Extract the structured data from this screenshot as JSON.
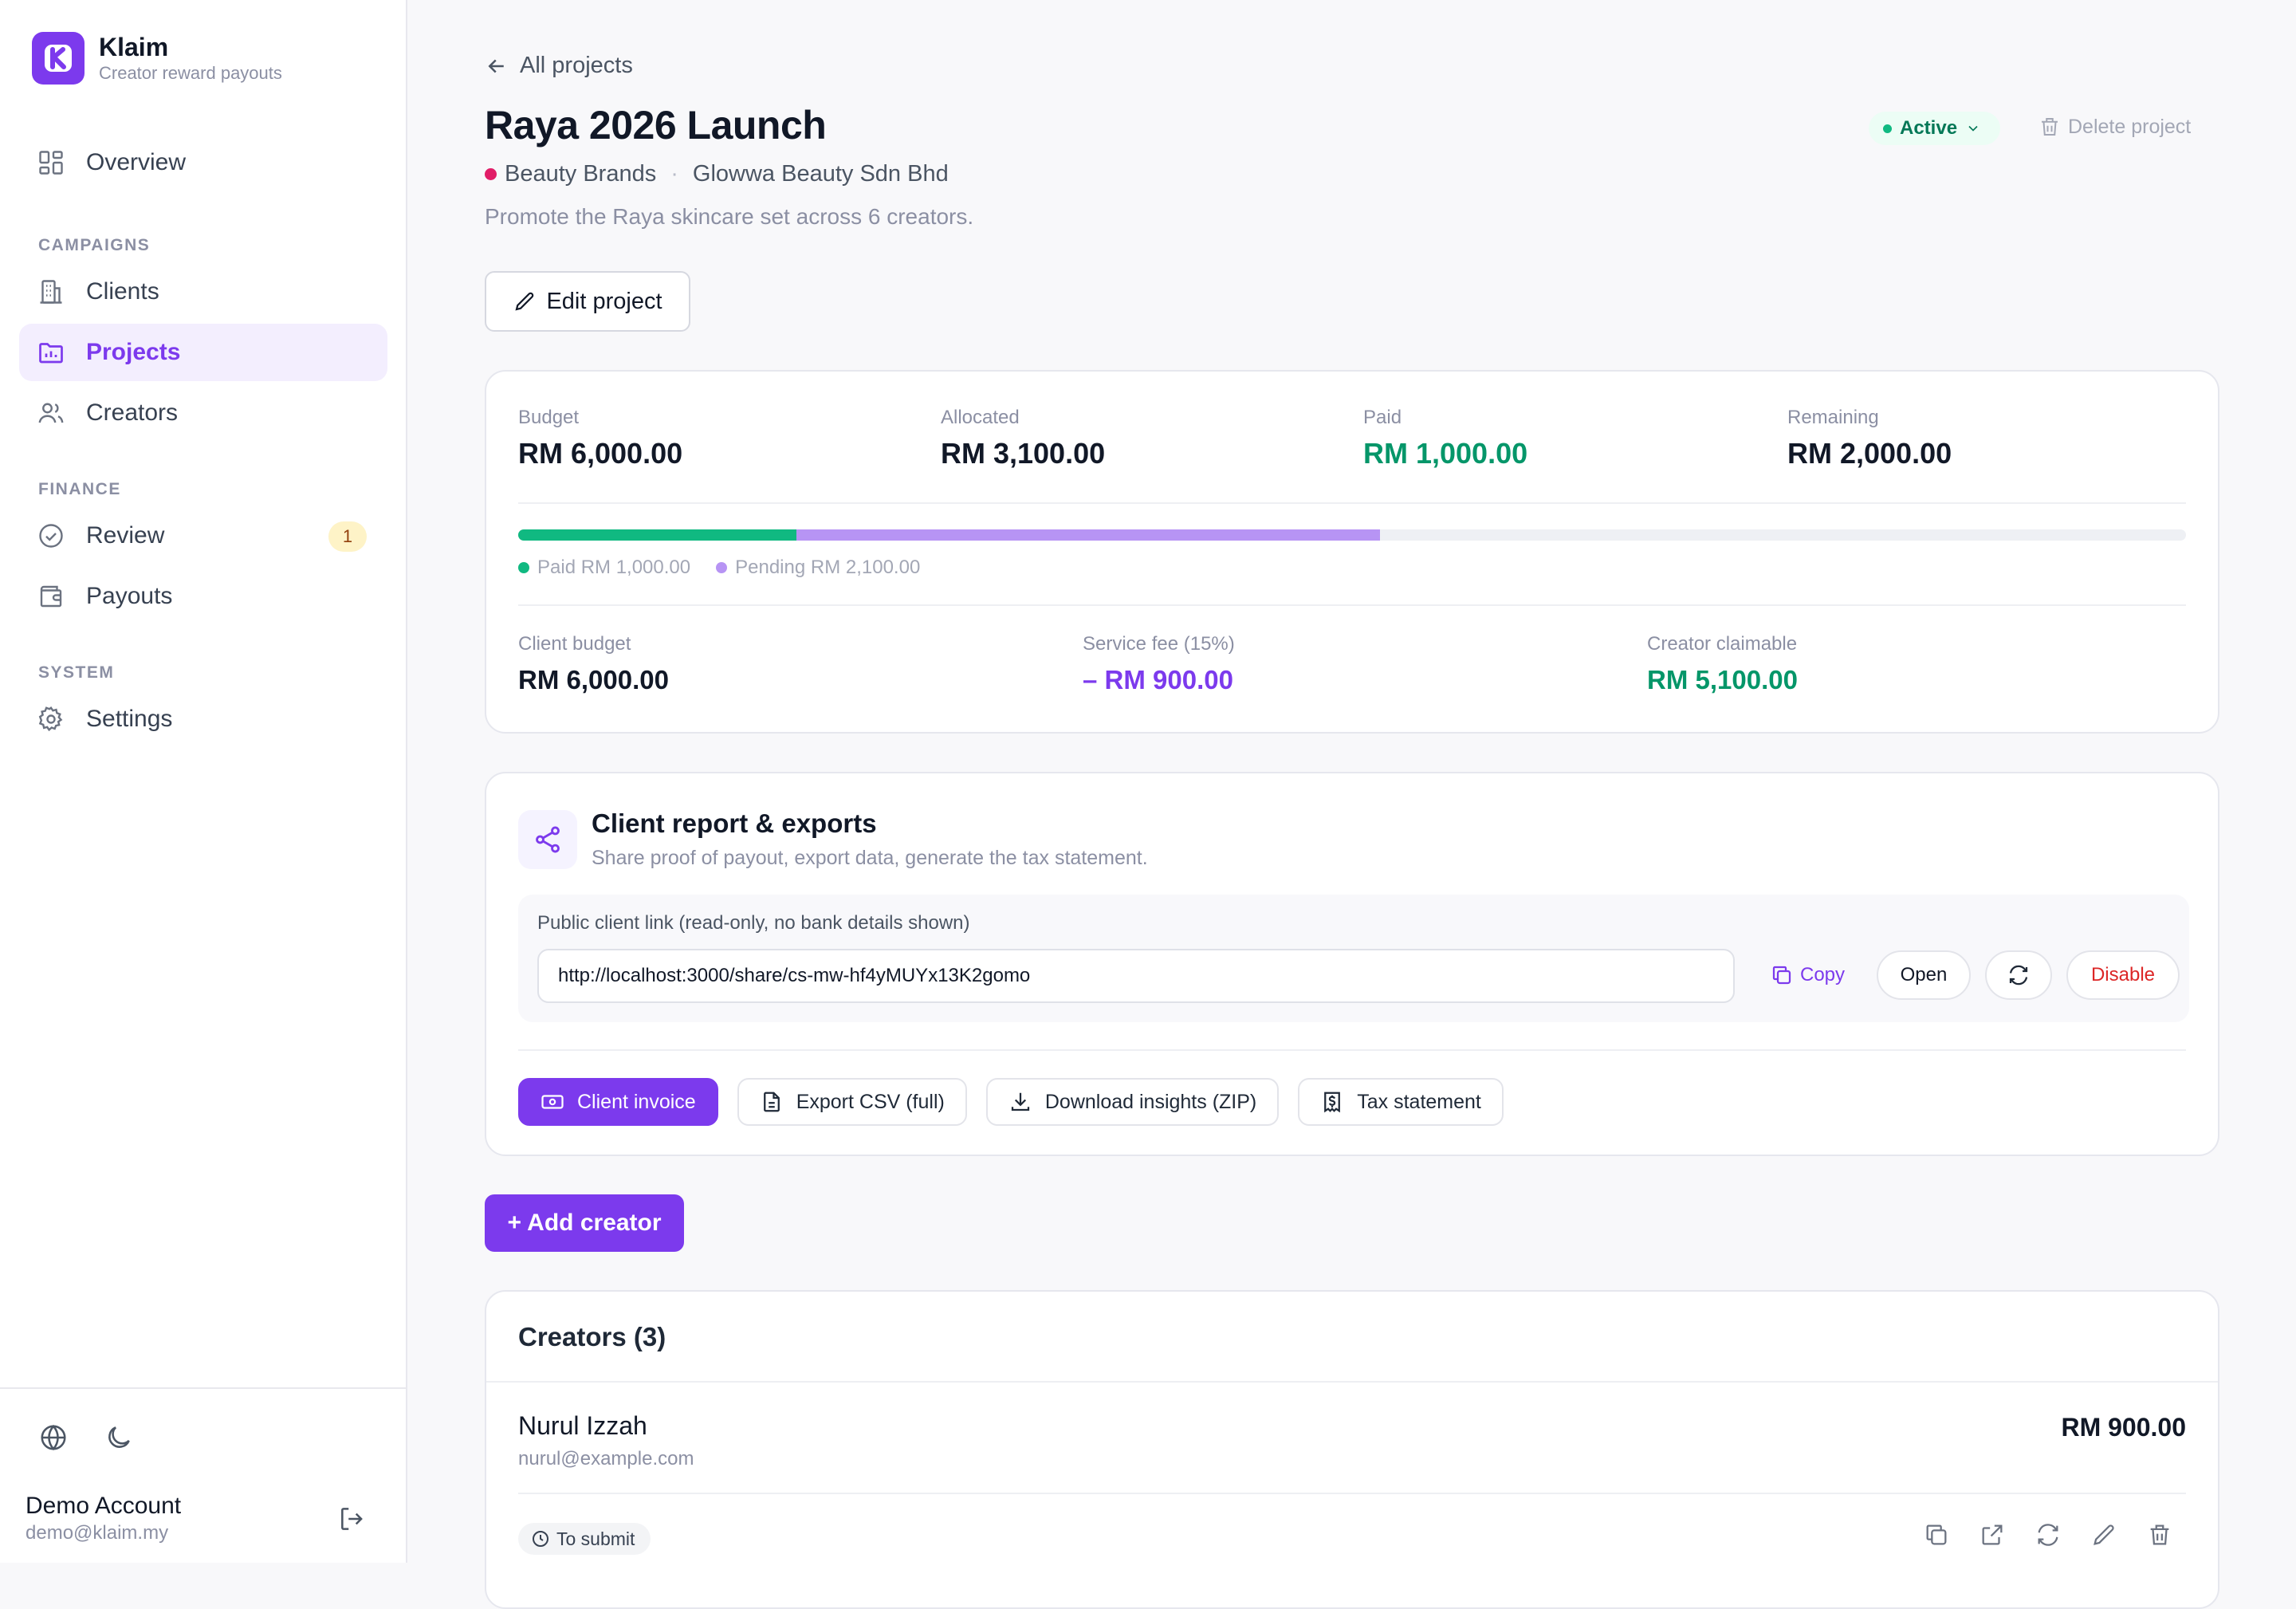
{
  "brand": {
    "name": "Klaim",
    "tagline": "Creator reward payouts",
    "logo_letter": "K",
    "accent": "#7c3aed"
  },
  "nav": {
    "overview": "Overview",
    "section_campaigns": "CAMPAIGNS",
    "clients": "Clients",
    "projects": "Projects",
    "creators": "Creators",
    "section_finance": "FINANCE",
    "review": "Review",
    "review_count": "1",
    "payouts": "Payouts",
    "section_system": "SYSTEM",
    "settings": "Settings",
    "active_item": "Projects"
  },
  "account": {
    "name": "Demo Account",
    "email": "demo@klaim.my"
  },
  "header": {
    "back_label": "All projects",
    "title": "Raya 2026 Launch",
    "category": "Beauty Brands",
    "client": "Glowwa Beauty Sdn Bhd",
    "separator": "·",
    "description": "Promote the Raya skincare set across 6 creators.",
    "status": "Active",
    "delete_label": "Delete project",
    "edit_label": "Edit project"
  },
  "budget": {
    "budget_label": "Budget",
    "budget_value": "RM 6,000.00",
    "allocated_label": "Allocated",
    "allocated_value": "RM 3,100.00",
    "paid_label": "Paid",
    "paid_value": "RM 1,000.00",
    "remaining_label": "Remaining",
    "remaining_value": "RM 2,000.00",
    "progress_paid_fraction": 0.1667,
    "progress_pending_fraction": 0.35,
    "legend_paid": "Paid RM 1,000.00",
    "legend_pending": "Pending RM 2,100.00",
    "client_budget_label": "Client budget",
    "client_budget_value": "RM 6,000.00",
    "fee_label": "Service fee (15%)",
    "fee_value": "– RM 900.00",
    "claimable_label": "Creator claimable",
    "claimable_value": "RM 5,100.00",
    "colors": {
      "paid": "#10b981",
      "pending": "#b794f4"
    }
  },
  "report": {
    "title": "Client report & exports",
    "subtitle": "Share proof of payout, export data, generate the tax statement.",
    "link_label": "Public client link (read-only, no bank details shown)",
    "link_value": "http://localhost:3000/share/cs-mw-hf4yMUYx13K2gomo",
    "copy_label": "Copy",
    "open_label": "Open",
    "disable_label": "Disable",
    "exports": {
      "invoice": "Client invoice",
      "csv": "Export CSV (full)",
      "insights": "Download insights (ZIP)",
      "tax": "Tax statement"
    }
  },
  "add_creator_label": "+ Add creator",
  "creators": {
    "title": "Creators (3)",
    "rows": [
      {
        "name": "Nurul Izzah",
        "email": "nurul@example.com",
        "amount": "RM 900.00",
        "status": "To submit"
      }
    ]
  }
}
